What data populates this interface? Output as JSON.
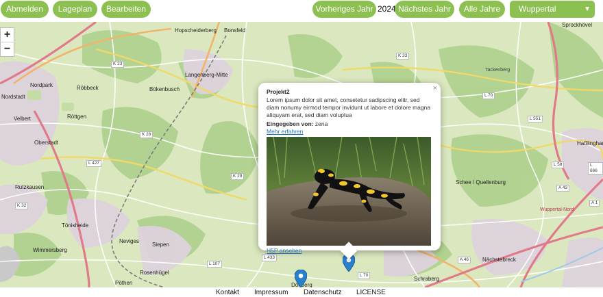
{
  "toolbar": {
    "logout_label": "Abmelden",
    "layout_label": "Lageplan",
    "edit_label": "Bearbeiten",
    "prev_year_label": "Vorheriges Jahr",
    "current_year": "2024",
    "next_year_label": "Nächstes Jahr",
    "all_years_label": "Alle Jahre",
    "city_select": "Wuppertal"
  },
  "colors": {
    "accent": "#8cc152",
    "link": "#1e73be",
    "marker": "#2a81cb"
  },
  "zoom": {
    "in_label": "+",
    "out_label": "−"
  },
  "popup": {
    "title": "Projekt2",
    "description": "Lorem ipsum dolor sit amet, consetetur sadipscing elitr, sed diam nonumy eirmod tempor invidunt ut labore et dolore magna aliquyam erat, sed diam voluptua",
    "author_label": "Eingegeben von:",
    "author": "zena",
    "more_link": "Mehr erfahren",
    "h5p_link": "H5P ansehen",
    "close": "×",
    "image_alt": "fire-salamander-photo"
  },
  "map_labels": {
    "hopscheiderberg": "Hopscheiderberg",
    "bonsfeld": "Bonsfeld",
    "langenberg": "Langenberg-Mitte",
    "nordpark": "Nordpark",
    "robbeck": "Röbbeck",
    "bokenbusch": "Bökenbusch",
    "nordstadt": "Nordstadt",
    "velbert": "Velbert",
    "rottgen": "Röttgen",
    "oberstadt": "Oberstadt",
    "rutzkausen": "Rutzkausen",
    "tonisheide": "Tönisheide",
    "wimmersberg": "Wimmersberg",
    "neviges": "Neviges",
    "siepen": "Siepen",
    "rosenhugel": "Rosenhügel",
    "pothen": "Pöthen",
    "dornberg": "Dönberg",
    "schrabberg": "Schraberg",
    "nachstebreck": "Nächstebreck",
    "schee": "Schee / Quellenburg",
    "sprockhovel": "Sprockhövel",
    "haßlinghausen": "Haßlinghausen",
    "tackenberg": "Tackenberg",
    "wuppertal_nord": "Wuppertal-Nord"
  },
  "road_tags": [
    "K 23",
    "K 33",
    "K 28",
    "K 29",
    "L 427",
    "K 32",
    "L 70",
    "L 551",
    "L 58",
    "L 666",
    "A 43",
    "A 1",
    "A 46",
    "L 433",
    "L 107",
    "L 70"
  ],
  "footer": {
    "contact": "Kontakt",
    "imprint": "Impressum",
    "privacy": "Datenschutz",
    "license": "LICENSE"
  }
}
